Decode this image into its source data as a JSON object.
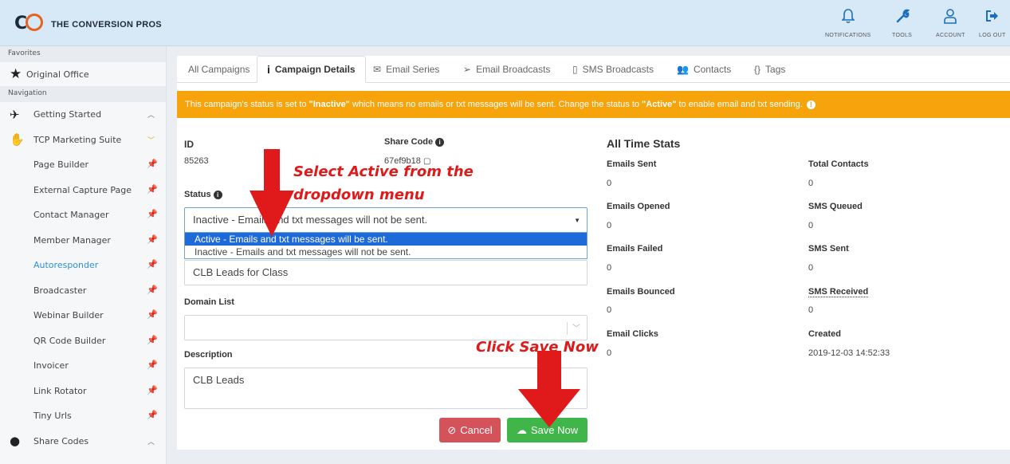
{
  "app": {
    "logo_mark": "CP",
    "logo_text": "THE CONVERSION PROS"
  },
  "topnav": [
    {
      "label": "NOTIFICATIONS",
      "icon": "bell-icon"
    },
    {
      "label": "TOOLS",
      "icon": "wrench-icon"
    },
    {
      "label": "ACCOUNT",
      "icon": "user-icon"
    },
    {
      "label": "LOG OUT",
      "icon": "logout-icon"
    }
  ],
  "sidebar": {
    "favorites_header": "Favorites",
    "favorite_item": "Original Office",
    "navigation_header": "Navigation",
    "items": [
      {
        "label": "Getting Started"
      },
      {
        "label": "TCP Marketing Suite"
      },
      {
        "label": "Page Builder"
      },
      {
        "label": "External Capture Page"
      },
      {
        "label": "Contact Manager"
      },
      {
        "label": "Member Manager"
      },
      {
        "label": "Autoresponder"
      },
      {
        "label": "Broadcaster"
      },
      {
        "label": "Webinar Builder"
      },
      {
        "label": "QR Code Builder"
      },
      {
        "label": "Invoicer"
      },
      {
        "label": "Link Rotator"
      },
      {
        "label": "Tiny Urls"
      },
      {
        "label": "Share Codes"
      }
    ]
  },
  "tabs": [
    {
      "label": "All Campaigns",
      "icon": ""
    },
    {
      "label": "Campaign Details",
      "icon": "info-icon"
    },
    {
      "label": "Email Series",
      "icon": "envelope-icon"
    },
    {
      "label": "Email Broadcasts",
      "icon": "paper-plane-icon"
    },
    {
      "label": "SMS Broadcasts",
      "icon": "mobile-icon"
    },
    {
      "label": "Contacts",
      "icon": "users-icon"
    },
    {
      "label": "Tags",
      "icon": "braces-icon"
    }
  ],
  "alert": {
    "pre": "This campaign's status is set to",
    "inactive": "\"Inactive\"",
    "mid": "which means no emails or txt messages will be sent. Change the status to",
    "active": "\"Active\"",
    "post": "to enable email and txt sending."
  },
  "form": {
    "id_label": "ID",
    "id_value": "85263",
    "share_code_label": "Share Code",
    "share_code_value": "67ef9b18",
    "status_label": "Status",
    "status_selected": "Inactive - Emails and txt messages will not be sent.",
    "status_options": [
      "Active - Emails and txt messages will be sent.",
      "Inactive - Emails and txt messages will not be sent."
    ],
    "name_value": "CLB Leads for Class",
    "domain_list_label": "Domain List",
    "domain_list_value": "",
    "description_label": "Description",
    "description_value": "CLB Leads",
    "cancel_label": "Cancel",
    "save_label": "Save Now"
  },
  "stats": {
    "title": "All Time Stats",
    "left": [
      {
        "label": "Emails Sent",
        "value": "0"
      },
      {
        "label": "Emails Opened",
        "value": "0"
      },
      {
        "label": "Emails Failed",
        "value": "0"
      },
      {
        "label": "Emails Bounced",
        "value": "0"
      },
      {
        "label": "Email Clicks",
        "value": "0"
      }
    ],
    "right": [
      {
        "label": "Total Contacts",
        "value": "0"
      },
      {
        "label": "SMS Queued",
        "value": "0"
      },
      {
        "label": "SMS Sent",
        "value": "0"
      },
      {
        "label": "SMS Received",
        "value": "0"
      },
      {
        "label": "Created",
        "value": "2019-12-03 14:52:33"
      }
    ]
  },
  "annotations": {
    "select_active_line1": "Select Active from the",
    "select_active_line2": "dropdown menu",
    "click_save": "Click Save Now"
  },
  "colors": {
    "accent_blue": "#2e8fd6",
    "alert_orange": "#f7a30c",
    "cancel_red": "#d4525a",
    "save_green": "#3fb54a",
    "annotation_red": "#e01a1a",
    "selected_option": "#1e6ad8"
  }
}
